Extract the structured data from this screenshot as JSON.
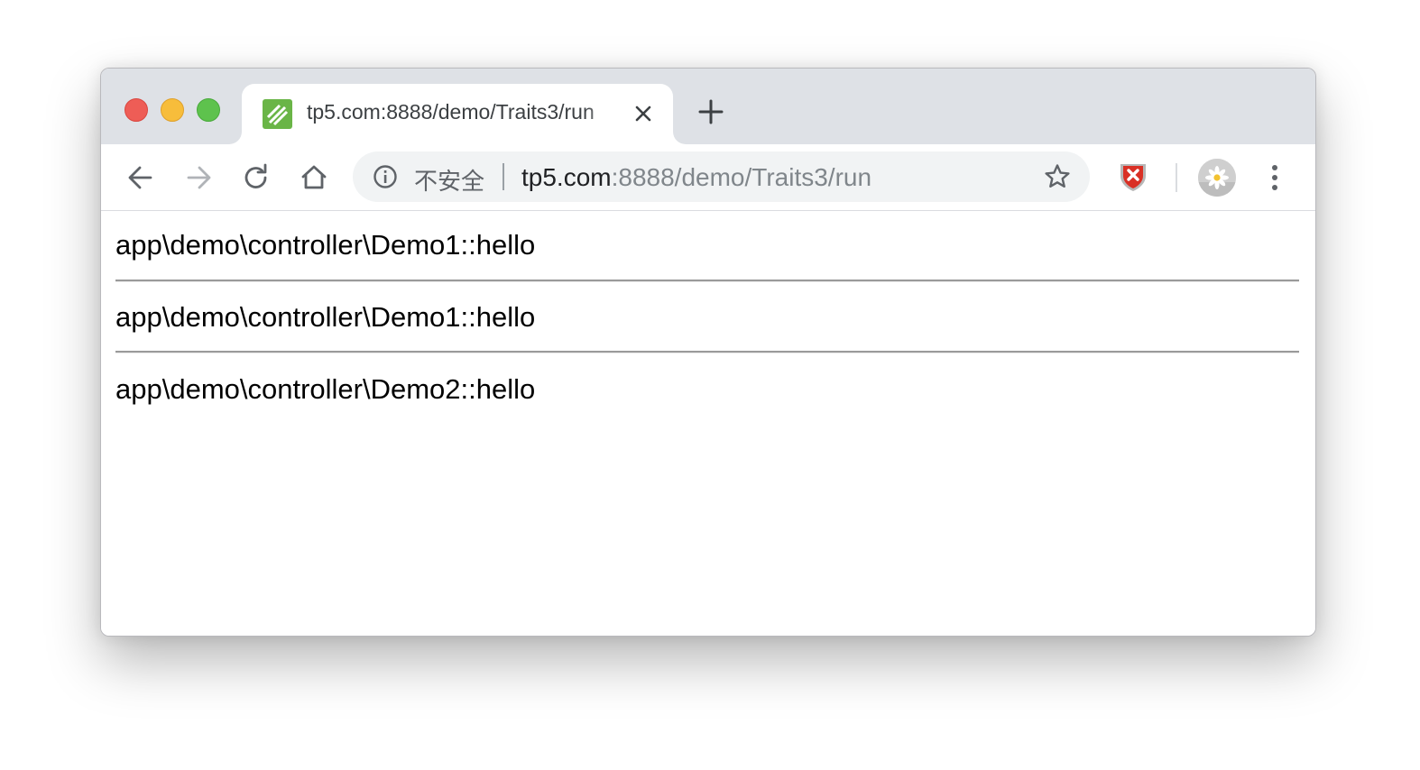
{
  "browser": {
    "tab": {
      "title": "tp5.com:8888/demo/Traits3/run",
      "favicon": "thinkphp-favicon"
    },
    "toolbar": {
      "security_label": "不安全",
      "url_host": "tp5.com",
      "url_rest": ":8888/demo/Traits3/run"
    },
    "icons": {
      "back": "arrow-left-icon",
      "forward": "arrow-right-icon",
      "reload": "reload-icon",
      "home": "home-icon",
      "info": "info-icon",
      "star": "star-icon",
      "extension": "shield-x-icon",
      "profile": "daisy-avatar-icon",
      "menu": "three-dot-menu-icon"
    },
    "colors": {
      "tabstrip": "#dee1e6",
      "close_red": "#ee5d56",
      "minimize_yellow": "#f7bd3b",
      "maximize_green": "#5ec24d",
      "favicon_green": "#6ab547",
      "extension_red": "#d93025"
    }
  },
  "page": {
    "lines": [
      "app\\demo\\controller\\Demo1::hello",
      "app\\demo\\controller\\Demo1::hello",
      "app\\demo\\controller\\Demo2::hello"
    ]
  }
}
